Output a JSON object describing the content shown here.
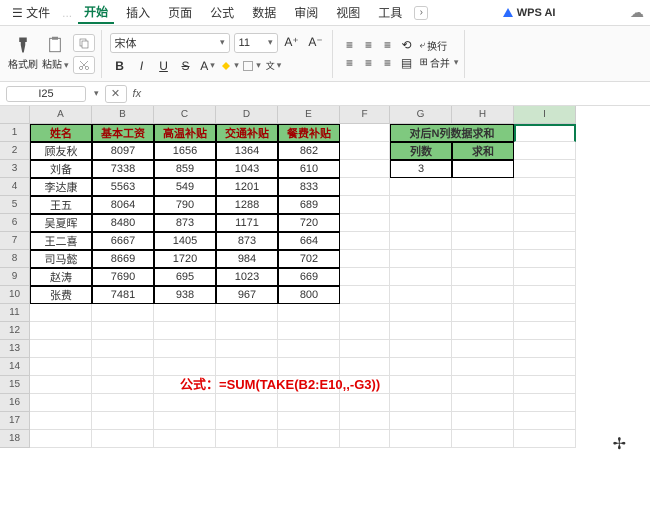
{
  "menu": {
    "file": "文件",
    "start": "开始",
    "insert": "插入",
    "page": "页面",
    "formula": "公式",
    "data": "数据",
    "review": "审阅",
    "view": "视图",
    "tools": "工具",
    "more": "..."
  },
  "wps_ai": "WPS AI",
  "ribbon": {
    "format_painter": "格式刷",
    "paste": "粘贴",
    "font_name": "宋体",
    "font_size": "11",
    "bold": "B",
    "italic": "I",
    "underline": "U",
    "strike": "S",
    "wrap": "换行",
    "merge": "合并"
  },
  "namebox": "I25",
  "fx": "fx",
  "cols": [
    "A",
    "B",
    "C",
    "D",
    "E",
    "F",
    "G",
    "H",
    "I"
  ],
  "rows_count": 18,
  "headers": [
    "姓名",
    "基本工资",
    "高温补贴",
    "交通补贴",
    "餐费补贴"
  ],
  "data_rows": [
    [
      "顾友秋",
      "8097",
      "1656",
      "1364",
      "862"
    ],
    [
      "刘备",
      "7338",
      "859",
      "1043",
      "610"
    ],
    [
      "李达康",
      "5563",
      "549",
      "1201",
      "833"
    ],
    [
      "王五",
      "8064",
      "790",
      "1288",
      "689"
    ],
    [
      "吴夏晖",
      "8480",
      "873",
      "1171",
      "720"
    ],
    [
      "王二喜",
      "6667",
      "1405",
      "873",
      "664"
    ],
    [
      "司马懿",
      "8669",
      "1720",
      "984",
      "702"
    ],
    [
      "赵涛",
      "7690",
      "695",
      "1023",
      "669"
    ],
    [
      "张费",
      "7481",
      "938",
      "967",
      "800"
    ]
  ],
  "table2": {
    "title": "对后N列数据求和",
    "col1": "列数",
    "col2": "求和",
    "n_value": "3",
    "sum_value": ""
  },
  "formula_note": "公式：=SUM(TAKE(B2:E10,,-G3))",
  "chart_data": {
    "type": "table",
    "title": "",
    "columns": [
      "姓名",
      "基本工资",
      "高温补贴",
      "交通补贴",
      "餐费补贴"
    ],
    "rows": [
      [
        "顾友秋",
        8097,
        1656,
        1364,
        862
      ],
      [
        "刘备",
        7338,
        859,
        1043,
        610
      ],
      [
        "李达康",
        5563,
        549,
        1201,
        833
      ],
      [
        "王五",
        8064,
        790,
        1288,
        689
      ],
      [
        "吴夏晖",
        8480,
        873,
        1171,
        720
      ],
      [
        "王二喜",
        6667,
        1405,
        873,
        664
      ],
      [
        "司马懿",
        8669,
        1720,
        984,
        702
      ],
      [
        "赵涛",
        7690,
        695,
        1023,
        669
      ],
      [
        "张费",
        7481,
        938,
        967,
        800
      ]
    ]
  }
}
